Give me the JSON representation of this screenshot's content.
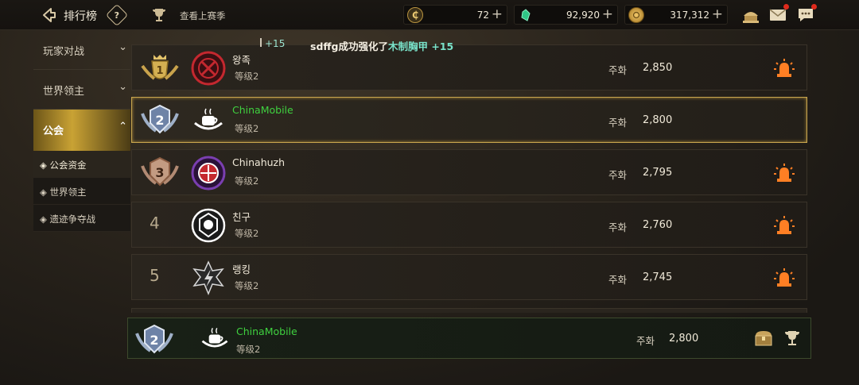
{
  "header": {
    "title": "排行榜",
    "help_symbol": "?",
    "last_season_label": "查看上赛季"
  },
  "currencies": [
    {
      "icon": "c-coin-icon",
      "symbol": "₵",
      "value": "72",
      "color": "#d8b45a"
    },
    {
      "icon": "green-gem-icon",
      "symbol": "",
      "value": "92,920",
      "color": "#39d08f"
    },
    {
      "icon": "gold-coin-icon",
      "symbol": "",
      "value": "317,312",
      "color": "#c99a3b"
    }
  ],
  "sidebar": {
    "categories": [
      {
        "label": "玩家对战"
      },
      {
        "label": "世界领主"
      },
      {
        "label": "公会"
      }
    ],
    "sub_items": [
      {
        "label": "◈ 公会资金"
      },
      {
        "label": "◈ 世界领主"
      },
      {
        "label": "◈ 遗迹争夺战"
      }
    ]
  },
  "notice": {
    "plus_text": "+15",
    "prefix": "sdffg成功强化了",
    "item": "木制胸甲",
    "suffix": " +15"
  },
  "rankings": [
    {
      "rank": "1",
      "name": "왕족",
      "level": "等级2",
      "metric": "주화",
      "score": "2,850",
      "name_color": "white"
    },
    {
      "rank": "2",
      "name": "ChinaMobile",
      "level": "等级2",
      "metric": "주화",
      "score": "2,800",
      "name_color": "green"
    },
    {
      "rank": "3",
      "name": "Chinahuzh",
      "level": "等级2",
      "metric": "주화",
      "score": "2,795",
      "name_color": "white"
    },
    {
      "rank": "4",
      "name": "친구",
      "level": "等级2",
      "metric": "주화",
      "score": "2,760",
      "name_color": "white"
    },
    {
      "rank": "5",
      "name": "랭킹",
      "level": "等级2",
      "metric": "주화",
      "score": "2,745",
      "name_color": "white"
    }
  ],
  "self_rank": {
    "rank": "2",
    "name": "ChinaMobile",
    "level": "等级2",
    "metric": "주화",
    "score": "2,800"
  }
}
